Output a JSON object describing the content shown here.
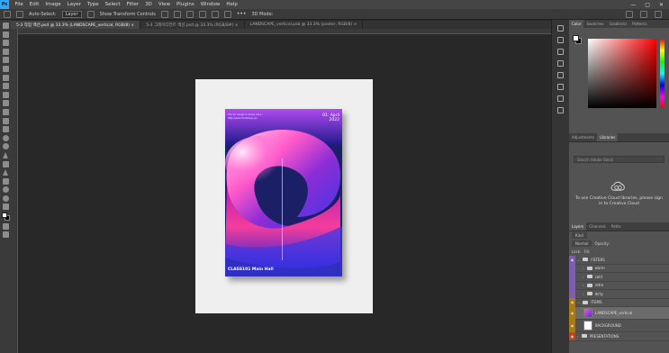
{
  "menu": {
    "logo": "Ps",
    "items": [
      "File",
      "Edit",
      "Image",
      "Layer",
      "Type",
      "Select",
      "Filter",
      "3D",
      "View",
      "Plugins",
      "Window",
      "Help"
    ],
    "window_controls": [
      "—",
      "▢",
      "✕"
    ]
  },
  "options": {
    "auto_select": "Auto-Select:",
    "layer_select": "Layer",
    "transform": "Show Transform Controls",
    "mode": "3D Mode:"
  },
  "tabs": [
    {
      "label": "5-3 작업 액션.psd @ 33.3% (LANDSCAPE_vertical, RGB/8) ×"
    },
    {
      "label": "5-3 그레이디언트 액션.psd @ 33.3% (RGB/8#) ×"
    },
    {
      "label": "LANDSCAPE_vertical.psb @ 33.3% (poster, RGB/8) ×"
    }
  ],
  "poster": {
    "small_text": "The art design in Korea here / http://www.muldesign.go",
    "date": "01. April 2022",
    "place": "CLASS101 Main Hall",
    "colors": {
      "bg": "#1a1f66",
      "pink": "#ff58c8",
      "violet": "#8d2dd6",
      "blue": "#3a36e8"
    }
  },
  "panels": {
    "color_tabs": [
      "Color",
      "Swatches",
      "Gradients",
      "Patterns"
    ],
    "lib_tabs": [
      "Adjustments",
      "Libraries"
    ],
    "lib_search": "Search Adobe Stock",
    "lib_message": "To use Creative Cloud libraries, please sign in to Creative Cloud",
    "layers_tabs": [
      "Layers",
      "Channels",
      "Paths"
    ],
    "layer_kind": "Kind",
    "blend_mode": "Normal",
    "opacity_label": "Opacity:",
    "lock_label": "Lock:",
    "fill_label": "Fill:",
    "layers": [
      {
        "name": "FILTERS",
        "type": "group",
        "color": "purple",
        "level": 0
      },
      {
        "name": "warm",
        "type": "group",
        "color": "purple",
        "level": 1
      },
      {
        "name": "cold",
        "type": "group",
        "color": "purple",
        "level": 1
      },
      {
        "name": "retro",
        "type": "group",
        "color": "purple",
        "level": 1
      },
      {
        "name": "dirty",
        "type": "group",
        "color": "purple",
        "level": 1
      },
      {
        "name": "ITEMS",
        "type": "group",
        "color": "gold",
        "level": 0
      },
      {
        "name": "LANDSCAPE_vertical",
        "type": "smart",
        "color": "gold",
        "level": 1
      },
      {
        "name": "BACKGROUND",
        "type": "white",
        "color": "gold",
        "level": 1
      },
      {
        "name": "PRESENTATIONS",
        "type": "group",
        "color": "red",
        "level": 0
      }
    ]
  }
}
